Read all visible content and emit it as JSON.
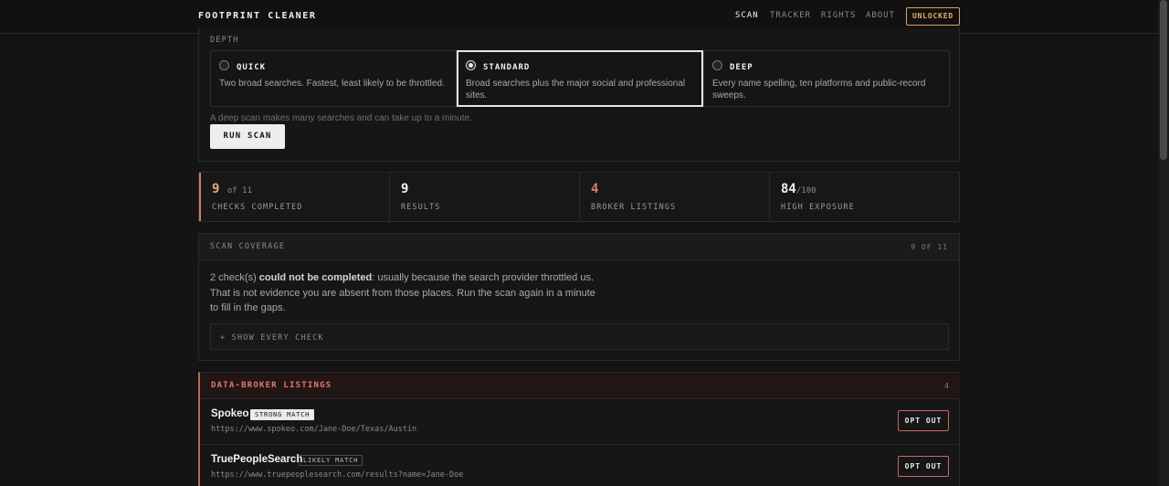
{
  "header": {
    "brand": "FOOTPRINT CLEANER",
    "nav": [
      "SCAN",
      "TRACKER",
      "RIGHTS",
      "ABOUT"
    ],
    "active_nav": "SCAN",
    "unlock_label": "UNLOCKED",
    "unlock_color": "#e6b25c"
  },
  "depth": {
    "label": "DEPTH",
    "options": [
      {
        "title": "QUICK",
        "description": "Two broad searches. Fastest, least likely to be throttled.",
        "selected": false
      },
      {
        "title": "STANDARD",
        "description": "Broad searches plus the major social and professional sites.",
        "selected": true
      },
      {
        "title": "DEEP",
        "description": "Every name spelling, ten platforms and public-record sweeps.",
        "selected": false
      }
    ],
    "hint": "A deep scan makes many searches and can take up to a minute.",
    "run_label": "RUN SCAN"
  },
  "stats": [
    {
      "value": "9",
      "suffix": "of 11",
      "label": "CHECKS COMPLETED"
    },
    {
      "value": "9",
      "suffix": "",
      "label": "RESULTS"
    },
    {
      "value": "4",
      "suffix": "",
      "label": "BROKER LISTINGS"
    },
    {
      "value": "84",
      "suffix": "/100",
      "label": "HIGH EXPOSURE"
    }
  ],
  "coverage": {
    "title": "SCAN COVERAGE",
    "count": "9 OF 11",
    "text_prefix": "2 check(s) ",
    "text_bold": "could not be completed",
    "text_suffix": ": usually because the search provider throttled us. That is not evidence you are absent from those places. Run the scan again in a minute to fill in the gaps.",
    "show_label": "+ SHOW EVERY CHECK"
  },
  "brokers": {
    "title": "DATA-BROKER LISTINGS",
    "count": "4",
    "items": [
      {
        "name": "Spokeo",
        "badge": "STRONG MATCH",
        "url": "https://www.spokeo.com/Jane-Doe/Texas/Austin",
        "action": "OPT OUT"
      },
      {
        "name": "TruePeopleSearch",
        "badge": "LIKELY MATCH",
        "url": "https://www.truepeoplesearch.com/results?name=Jane-Doe",
        "action": "OPT OUT"
      }
    ]
  }
}
